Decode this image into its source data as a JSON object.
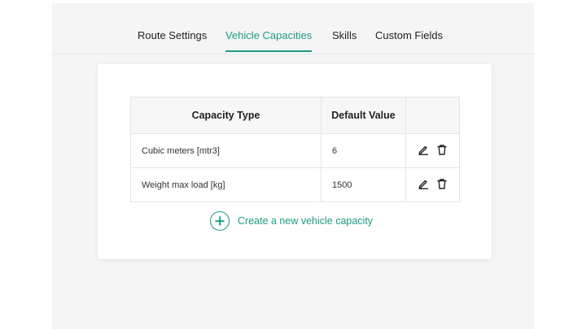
{
  "tabs": [
    {
      "label": "Route Settings",
      "active": false
    },
    {
      "label": "Vehicle Capacities",
      "active": true
    },
    {
      "label": "Skills",
      "active": false
    },
    {
      "label": "Custom Fields",
      "active": false
    }
  ],
  "table": {
    "headers": [
      "Capacity Type",
      "Default Value",
      ""
    ],
    "rows": [
      {
        "type": "Cubic meters [mtr3]",
        "value": "6"
      },
      {
        "type": "Weight max load [kg]",
        "value": "1500"
      }
    ]
  },
  "actions": {
    "add_label": "Create a new vehicle capacity"
  },
  "icons": {
    "edit": "pencil-icon",
    "delete": "trash-icon",
    "add": "plus-circle-icon"
  },
  "colors": {
    "accent": "#1d9a84",
    "background": "#f5f5f5",
    "card": "#ffffff"
  }
}
